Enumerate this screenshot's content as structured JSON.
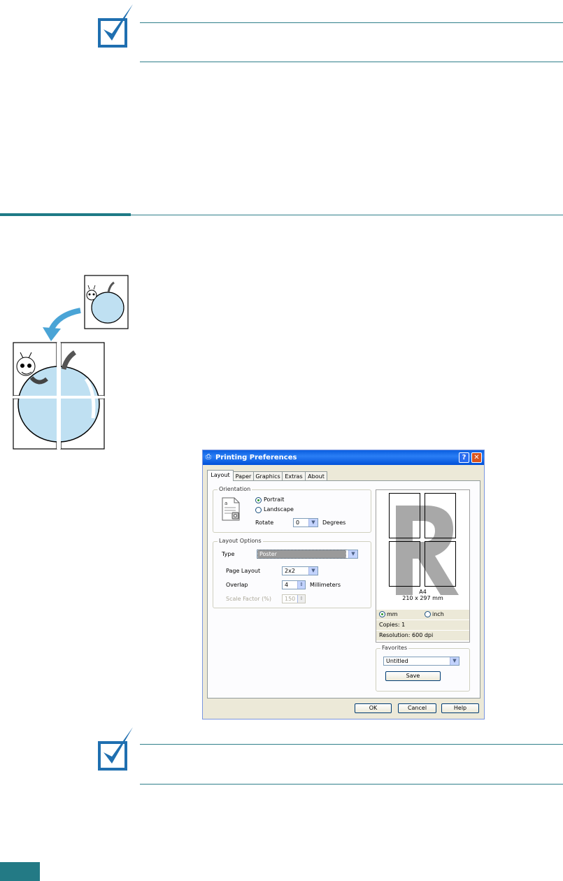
{
  "dialog": {
    "title": "Printing Preferences",
    "help_glyph": "?",
    "close_glyph": "✕",
    "tabs": [
      {
        "label": "Layout"
      },
      {
        "label": "Paper"
      },
      {
        "label": "Graphics"
      },
      {
        "label": "Extras"
      },
      {
        "label": "About"
      }
    ],
    "orientation": {
      "group_label": "Orientation",
      "portrait_label": "Portrait",
      "landscape_label": "Landscape",
      "selected": "Portrait",
      "rotate_label": "Rotate",
      "rotate_value": "0",
      "degrees_label": "Degrees"
    },
    "layout_options": {
      "group_label": "Layout Options",
      "type_label": "Type",
      "type_value": "Poster",
      "page_layout_label": "Page Layout",
      "page_layout_value": "2x2",
      "overlap_label": "Overlap",
      "overlap_value": "4",
      "overlap_unit": "Millimeters",
      "scale_label": "Scale Factor (%)",
      "scale_value": "150"
    },
    "preview": {
      "paper_name": "A4",
      "paper_size": "210 x 297 mm",
      "unit_mm": "mm",
      "unit_inch": "inch",
      "selected_unit": "mm",
      "copies": "Copies: 1",
      "resolution": "Resolution: 600 dpi"
    },
    "favorites": {
      "group_label": "Favorites",
      "value": "Untitled",
      "save_label": "Save"
    },
    "buttons": {
      "ok": "OK",
      "cancel": "Cancel",
      "help": "Help"
    }
  },
  "colors": {
    "accent_rule": "#1e7a86",
    "check_blue": "#1f6fb0",
    "apple_fill": "#bfe0f2"
  }
}
